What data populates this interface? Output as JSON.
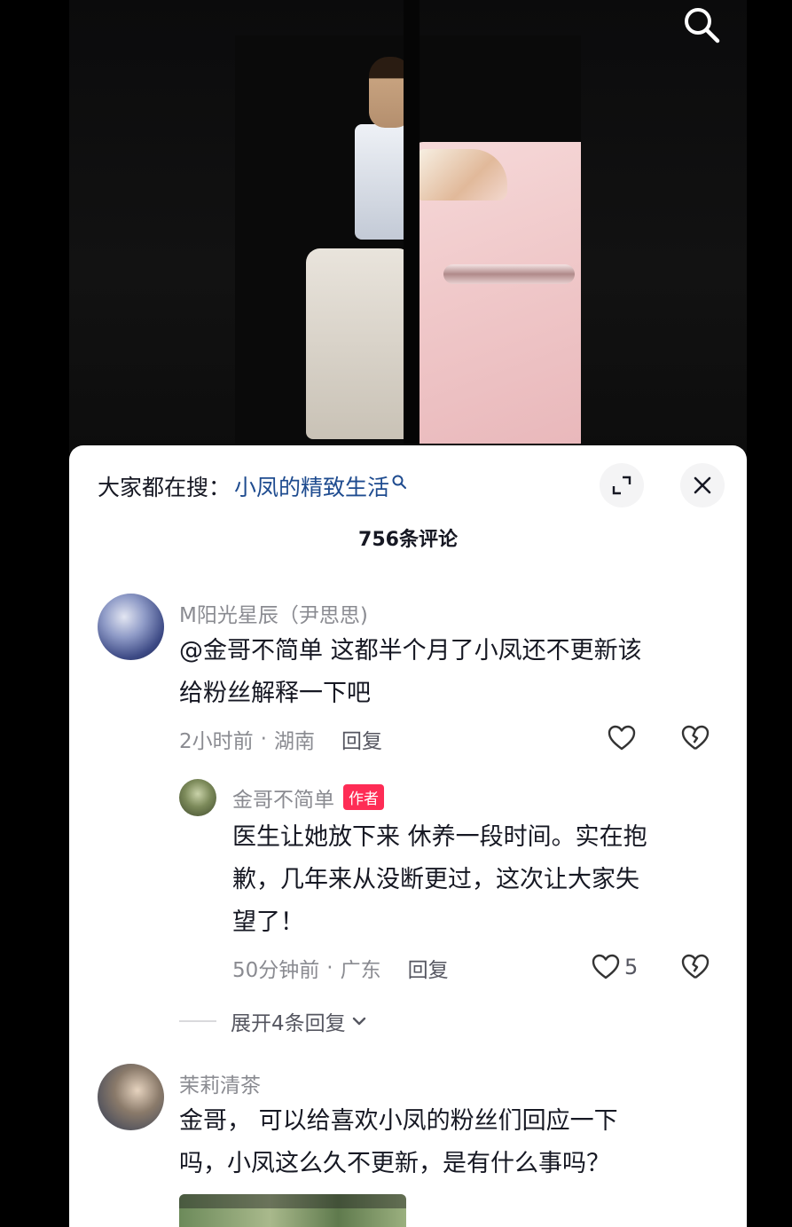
{
  "search_bar": {
    "prefix": "大家都在搜：",
    "term": "小凤的精致生活"
  },
  "comment_count": "756条评论",
  "comments": [
    {
      "username": "M阳光星辰（尹思思)",
      "text_line1": "@金哥不简单 这都半个月了小凤还不更新该",
      "text_line2": "给粉丝解释一下吧",
      "time": "2小时前",
      "separator": "·",
      "location": "湖南",
      "reply_label": "回复",
      "like_count": "",
      "replies": [
        {
          "username": "金哥不简单",
          "badge": "作者",
          "text_line1": "医生让她放下来 休养一段时间。实在抱",
          "text_line2": "歉，几年来从没断更过，这次让大家失",
          "text_line3": "望了！",
          "time": "50分钟前",
          "separator": "·",
          "location": "广东",
          "reply_label": "回复",
          "like_count": "5"
        }
      ],
      "expand_label": "展开4条回复"
    },
    {
      "username": "茉莉清茶",
      "text_line1": "金哥，  可以给喜欢小凤的粉丝们回应一下",
      "text_line2": "吗，小凤这么久不更新，是有什么事吗？"
    }
  ],
  "icons": {
    "search": "search-icon",
    "expand": "expand-icon",
    "close": "close-icon",
    "like": "heart-icon",
    "dislike": "broken-heart-icon",
    "chevron": "chevron-down-icon"
  },
  "colors": {
    "accent_link": "#1e4b8f",
    "author_badge": "#fe2c55",
    "muted_text": "#8a8b91"
  }
}
